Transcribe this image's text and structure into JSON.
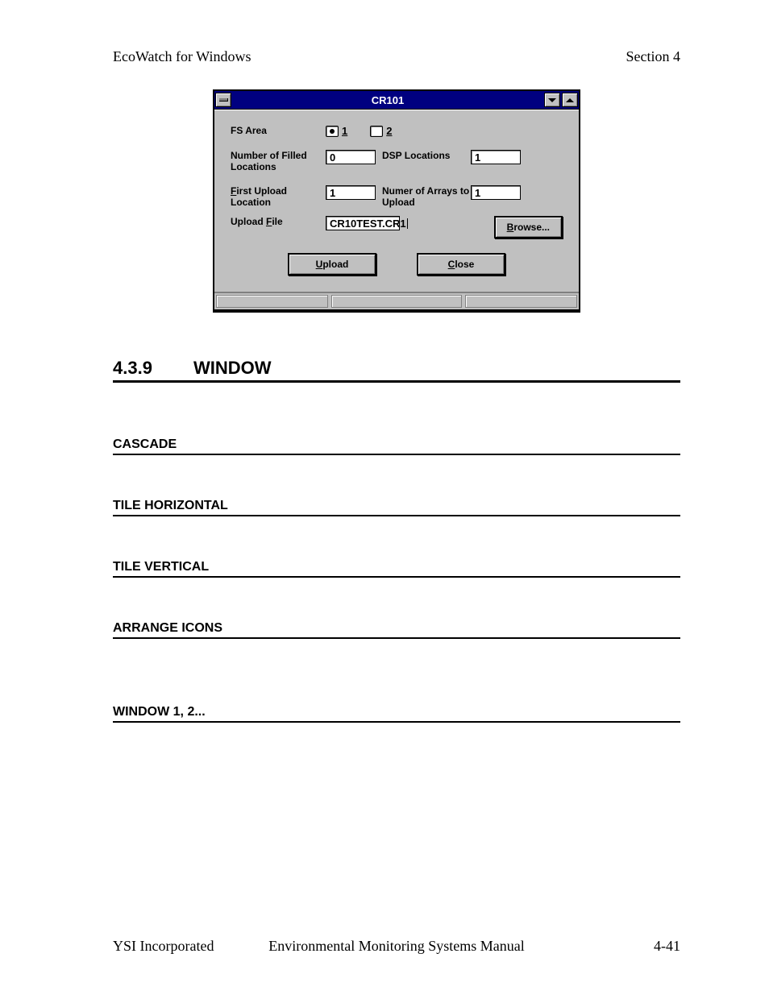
{
  "header": {
    "left": "EcoWatch for Windows",
    "right": "Section 4"
  },
  "dialog": {
    "title": "CR101",
    "rows": {
      "fsarea": {
        "label": "FS Area",
        "radio1": "1",
        "radio2": "2",
        "selected": 1
      },
      "filled": {
        "label": "Number of Filled Locations",
        "value": "0"
      },
      "dsp": {
        "label": "DSP Locations",
        "value": "1"
      },
      "firstupload": {
        "label": "First Upload Location",
        "value": "1",
        "mnemonic": "F"
      },
      "numarrays": {
        "label": "Numer of Arrays to Upload",
        "value": "1"
      },
      "uploadfile": {
        "label": "Upload File",
        "value": "CR10TEST.CR1",
        "mnemonic": "F"
      }
    },
    "buttons": {
      "browse": "Browse...",
      "upload": "Upload",
      "close": "Close"
    }
  },
  "section": {
    "number": "4.3.9",
    "title": "WINDOW"
  },
  "subs": {
    "cascade": "CASCADE",
    "tileh": "TILE HORIZONTAL",
    "tilev": "TILE VERTICAL",
    "arrange": "ARRANGE ICONS",
    "win12": "WINDOW 1, 2..."
  },
  "footer": {
    "left": "YSI Incorporated",
    "mid": "Environmental Monitoring Systems Manual",
    "right": "4-41"
  }
}
